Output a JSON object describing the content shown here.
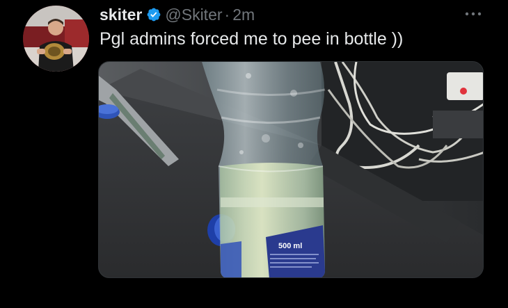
{
  "tweet": {
    "display_name": "skiter",
    "handle": "@Skiter",
    "separator": "·",
    "time": "2m",
    "text": "Pgl admins forced me to pee in bottle ))",
    "more_glyph": "•••"
  },
  "media": {
    "label_volume": "500 ml"
  },
  "icons": {
    "verified": "verified-badge-icon",
    "more": "more-options-icon"
  },
  "colors": {
    "background": "#000000",
    "primary_text": "#e7e9ea",
    "secondary_text": "#71767b",
    "verified_blue": "#1d9bf0"
  }
}
